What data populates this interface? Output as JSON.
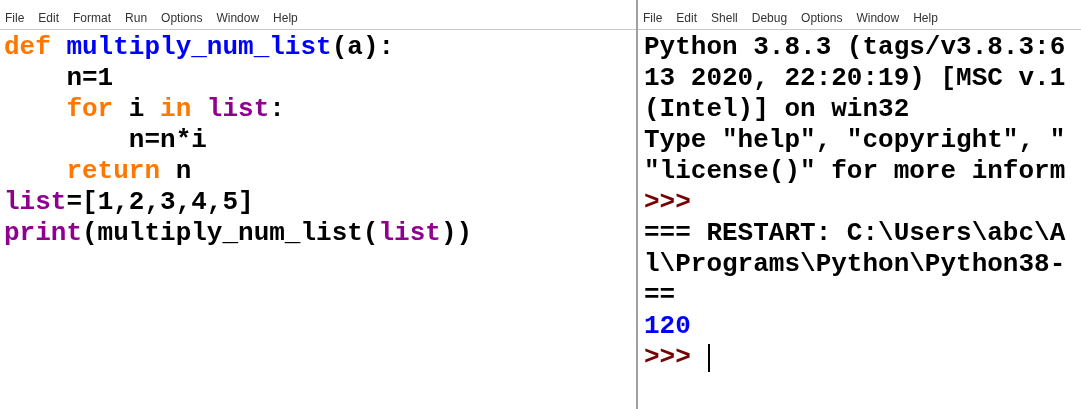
{
  "editor": {
    "menu": [
      "File",
      "Edit",
      "Format",
      "Run",
      "Options",
      "Window",
      "Help"
    ],
    "lines": [
      {
        "tokens": [
          {
            "text": "def",
            "kind": "keyword"
          },
          {
            "text": " multiply_num_list",
            "kind": "definition"
          },
          {
            "text": "(a):",
            "kind": "plain"
          }
        ]
      },
      {
        "tokens": [
          {
            "text": "    n=1",
            "kind": "plain"
          }
        ]
      },
      {
        "tokens": [
          {
            "text": "    for",
            "kind": "keyword"
          },
          {
            "text": " i ",
            "kind": "plain"
          },
          {
            "text": "in",
            "kind": "keyword"
          },
          {
            "text": " list",
            "kind": "builtin"
          },
          {
            "text": ":",
            "kind": "plain"
          }
        ]
      },
      {
        "tokens": [
          {
            "text": "        n=n*i",
            "kind": "plain"
          }
        ]
      },
      {
        "tokens": [
          {
            "text": "    return",
            "kind": "keyword"
          },
          {
            "text": " n",
            "kind": "plain"
          }
        ]
      },
      {
        "tokens": [
          {
            "text": "list",
            "kind": "builtin"
          },
          {
            "text": "=[1,2,3,4,5]",
            "kind": "plain"
          }
        ]
      },
      {
        "tokens": [
          {
            "text": "print",
            "kind": "builtin"
          },
          {
            "text": "(multiply_num_list(",
            "kind": "plain"
          },
          {
            "text": "list",
            "kind": "builtin"
          },
          {
            "text": "))",
            "kind": "plain"
          }
        ]
      }
    ]
  },
  "shell": {
    "menu": [
      "File",
      "Edit",
      "Shell",
      "Debug",
      "Options",
      "Window",
      "Help"
    ],
    "lines": [
      {
        "tokens": [
          {
            "text": "Python 3.8.3 (tags/v3.8.3:6",
            "kind": "plain"
          }
        ]
      },
      {
        "tokens": [
          {
            "text": "13 2020, 22:20:19) [MSC v.1",
            "kind": "plain"
          }
        ]
      },
      {
        "tokens": [
          {
            "text": "(Intel)] on win32",
            "kind": "plain"
          }
        ]
      },
      {
        "tokens": [
          {
            "text": "Type \"help\", \"copyright\", \"",
            "kind": "plain"
          }
        ]
      },
      {
        "tokens": [
          {
            "text": "\"license()\" for more inform",
            "kind": "plain"
          }
        ]
      },
      {
        "tokens": [
          {
            "text": ">>>",
            "kind": "prompt"
          }
        ]
      },
      {
        "tokens": [
          {
            "text": "=== RESTART: C:\\Users\\abc\\A",
            "kind": "plain"
          }
        ]
      },
      {
        "tokens": [
          {
            "text": "l\\Programs\\Python\\Python38-",
            "kind": "plain"
          }
        ]
      },
      {
        "tokens": [
          {
            "text": "==",
            "kind": "plain"
          }
        ]
      },
      {
        "tokens": [
          {
            "text": "120",
            "kind": "output"
          }
        ]
      },
      {
        "tokens": [
          {
            "text": ">>> ",
            "kind": "prompt"
          }
        ],
        "cursor": true
      }
    ]
  }
}
